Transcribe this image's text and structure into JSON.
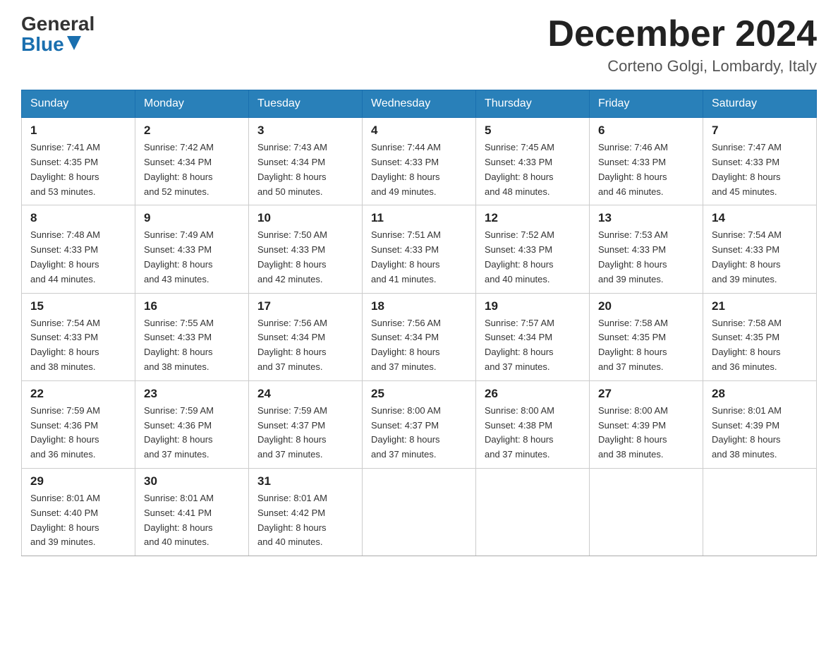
{
  "header": {
    "logo_general": "General",
    "logo_blue": "Blue",
    "month_year": "December 2024",
    "location": "Corteno Golgi, Lombardy, Italy"
  },
  "weekdays": [
    "Sunday",
    "Monday",
    "Tuesday",
    "Wednesday",
    "Thursday",
    "Friday",
    "Saturday"
  ],
  "weeks": [
    [
      {
        "day": "1",
        "sunrise": "7:41 AM",
        "sunset": "4:35 PM",
        "daylight": "8 hours and 53 minutes."
      },
      {
        "day": "2",
        "sunrise": "7:42 AM",
        "sunset": "4:34 PM",
        "daylight": "8 hours and 52 minutes."
      },
      {
        "day": "3",
        "sunrise": "7:43 AM",
        "sunset": "4:34 PM",
        "daylight": "8 hours and 50 minutes."
      },
      {
        "day": "4",
        "sunrise": "7:44 AM",
        "sunset": "4:33 PM",
        "daylight": "8 hours and 49 minutes."
      },
      {
        "day": "5",
        "sunrise": "7:45 AM",
        "sunset": "4:33 PM",
        "daylight": "8 hours and 48 minutes."
      },
      {
        "day": "6",
        "sunrise": "7:46 AM",
        "sunset": "4:33 PM",
        "daylight": "8 hours and 46 minutes."
      },
      {
        "day": "7",
        "sunrise": "7:47 AM",
        "sunset": "4:33 PM",
        "daylight": "8 hours and 45 minutes."
      }
    ],
    [
      {
        "day": "8",
        "sunrise": "7:48 AM",
        "sunset": "4:33 PM",
        "daylight": "8 hours and 44 minutes."
      },
      {
        "day": "9",
        "sunrise": "7:49 AM",
        "sunset": "4:33 PM",
        "daylight": "8 hours and 43 minutes."
      },
      {
        "day": "10",
        "sunrise": "7:50 AM",
        "sunset": "4:33 PM",
        "daylight": "8 hours and 42 minutes."
      },
      {
        "day": "11",
        "sunrise": "7:51 AM",
        "sunset": "4:33 PM",
        "daylight": "8 hours and 41 minutes."
      },
      {
        "day": "12",
        "sunrise": "7:52 AM",
        "sunset": "4:33 PM",
        "daylight": "8 hours and 40 minutes."
      },
      {
        "day": "13",
        "sunrise": "7:53 AM",
        "sunset": "4:33 PM",
        "daylight": "8 hours and 39 minutes."
      },
      {
        "day": "14",
        "sunrise": "7:54 AM",
        "sunset": "4:33 PM",
        "daylight": "8 hours and 39 minutes."
      }
    ],
    [
      {
        "day": "15",
        "sunrise": "7:54 AM",
        "sunset": "4:33 PM",
        "daylight": "8 hours and 38 minutes."
      },
      {
        "day": "16",
        "sunrise": "7:55 AM",
        "sunset": "4:33 PM",
        "daylight": "8 hours and 38 minutes."
      },
      {
        "day": "17",
        "sunrise": "7:56 AM",
        "sunset": "4:34 PM",
        "daylight": "8 hours and 37 minutes."
      },
      {
        "day": "18",
        "sunrise": "7:56 AM",
        "sunset": "4:34 PM",
        "daylight": "8 hours and 37 minutes."
      },
      {
        "day": "19",
        "sunrise": "7:57 AM",
        "sunset": "4:34 PM",
        "daylight": "8 hours and 37 minutes."
      },
      {
        "day": "20",
        "sunrise": "7:58 AM",
        "sunset": "4:35 PM",
        "daylight": "8 hours and 37 minutes."
      },
      {
        "day": "21",
        "sunrise": "7:58 AM",
        "sunset": "4:35 PM",
        "daylight": "8 hours and 36 minutes."
      }
    ],
    [
      {
        "day": "22",
        "sunrise": "7:59 AM",
        "sunset": "4:36 PM",
        "daylight": "8 hours and 36 minutes."
      },
      {
        "day": "23",
        "sunrise": "7:59 AM",
        "sunset": "4:36 PM",
        "daylight": "8 hours and 37 minutes."
      },
      {
        "day": "24",
        "sunrise": "7:59 AM",
        "sunset": "4:37 PM",
        "daylight": "8 hours and 37 minutes."
      },
      {
        "day": "25",
        "sunrise": "8:00 AM",
        "sunset": "4:37 PM",
        "daylight": "8 hours and 37 minutes."
      },
      {
        "day": "26",
        "sunrise": "8:00 AM",
        "sunset": "4:38 PM",
        "daylight": "8 hours and 37 minutes."
      },
      {
        "day": "27",
        "sunrise": "8:00 AM",
        "sunset": "4:39 PM",
        "daylight": "8 hours and 38 minutes."
      },
      {
        "day": "28",
        "sunrise": "8:01 AM",
        "sunset": "4:39 PM",
        "daylight": "8 hours and 38 minutes."
      }
    ],
    [
      {
        "day": "29",
        "sunrise": "8:01 AM",
        "sunset": "4:40 PM",
        "daylight": "8 hours and 39 minutes."
      },
      {
        "day": "30",
        "sunrise": "8:01 AM",
        "sunset": "4:41 PM",
        "daylight": "8 hours and 40 minutes."
      },
      {
        "day": "31",
        "sunrise": "8:01 AM",
        "sunset": "4:42 PM",
        "daylight": "8 hours and 40 minutes."
      },
      null,
      null,
      null,
      null
    ]
  ],
  "labels": {
    "sunrise": "Sunrise:",
    "sunset": "Sunset:",
    "daylight": "Daylight:"
  }
}
